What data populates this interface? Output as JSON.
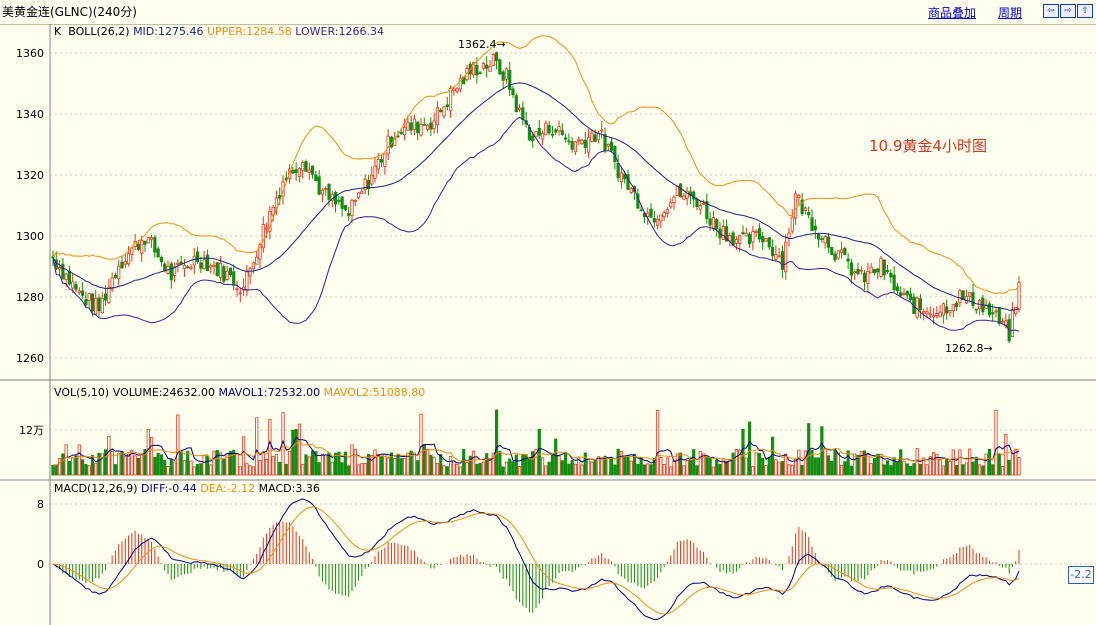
{
  "window": {
    "title": "美黄金连(GLNC)(240分)",
    "links": [
      "商品叠加",
      "周期"
    ],
    "nav_buttons": [
      "⇦",
      "⇨",
      "⇧"
    ]
  },
  "annotation": "10.9黄金4小时图",
  "colors": {
    "up": "#e8321e",
    "down": "#138c13",
    "mid": "#1a237e",
    "upper": "#f08c14",
    "lower": "#3c1e96",
    "dea": "#f08c14",
    "diff": "#000080",
    "grid": "#c8c8b4"
  },
  "price_panel": {
    "label_k": "K",
    "boll": "BOLL(26,2)",
    "mid": "MID:1275.46",
    "upper": "UPPER:1284.58",
    "lower": "LOWER:1266.34",
    "high_label": "1362.4",
    "low_label": "1262.8",
    "ticks": [
      "1360",
      "1340",
      "1320",
      "1300",
      "1280",
      "1260"
    ]
  },
  "vol_panel": {
    "label": "VOL(5,10)",
    "volume": "VOLUME:24632.00",
    "mavol1": "MAVOL1:72532.00",
    "mavol2": "MAVOL2:51088.80",
    "tick": "12万"
  },
  "macd_panel": {
    "label": "MACD(12,26,9)",
    "diff": "DIFF:-0.44",
    "dea": "DEA:-2.12",
    "macd": "MACD:3.36",
    "ticks": [
      "8",
      "0"
    ],
    "badge": "-2.2"
  },
  "chart_data": [
    {
      "type": "candlestick",
      "title": "",
      "series": [
        "K",
        "MID",
        "UPPER",
        "LOWER"
      ],
      "ylim": [
        1255,
        1368
      ],
      "yticks": [
        1360,
        1340,
        1320,
        1300,
        1280,
        1260
      ],
      "last": {
        "mid": 1275.46,
        "upper": 1284.58,
        "lower": 1266.34
      },
      "extremes": {
        "high": 1362.4,
        "low": 1262.8
      }
    },
    {
      "type": "bar",
      "series": [
        "VOLUME",
        "MAVOL1",
        "MAVOL2"
      ],
      "last": {
        "volume": 24632.0,
        "mavol1": 72532.0,
        "mavol2": 51088.8
      },
      "yticks": [
        "12万"
      ]
    },
    {
      "type": "bar",
      "series": [
        "DIFF",
        "DEA",
        "MACD"
      ],
      "last": {
        "diff": -0.44,
        "dea": -2.12,
        "macd": 3.36
      },
      "yticks": [
        8,
        0
      ]
    }
  ]
}
